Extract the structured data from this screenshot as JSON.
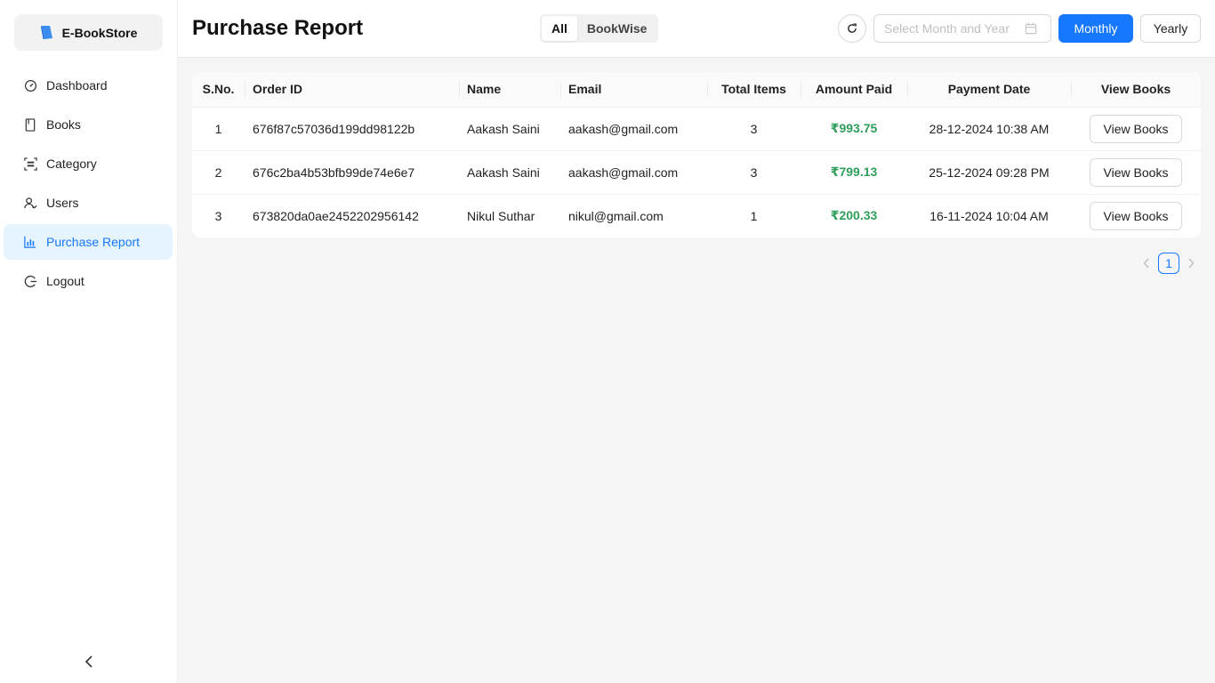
{
  "sidebar": {
    "brand": "E-BookStore",
    "items": [
      {
        "label": "Dashboard",
        "icon": "dashboard-icon"
      },
      {
        "label": "Books",
        "icon": "book-icon"
      },
      {
        "label": "Category",
        "icon": "category-icon"
      },
      {
        "label": "Users",
        "icon": "users-icon"
      },
      {
        "label": "Purchase Report",
        "icon": "bar-chart-icon",
        "active": true
      },
      {
        "label": "Logout",
        "icon": "logout-icon"
      }
    ]
  },
  "header": {
    "title": "Purchase Report",
    "segments": [
      "All",
      "BookWise"
    ],
    "selected_segment": "All",
    "date_placeholder": "Select Month and Year",
    "monthly_label": "Monthly",
    "yearly_label": "Yearly"
  },
  "table": {
    "columns": [
      "S.No.",
      "Order ID",
      "Name",
      "Email",
      "Total Items",
      "Amount Paid",
      "Payment Date",
      "View Books"
    ],
    "rows": [
      {
        "sno": "1",
        "order_id": "676f87c57036d199dd98122b",
        "name": "Aakash Saini",
        "email": "aakash@gmail.com",
        "items": "3",
        "amount": "₹993.75",
        "date": "28-12-2024 10:38 AM",
        "action": "View Books"
      },
      {
        "sno": "2",
        "order_id": "676c2ba4b53bfb99de74e6e7",
        "name": "Aakash Saini",
        "email": "aakash@gmail.com",
        "items": "3",
        "amount": "₹799.13",
        "date": "25-12-2024 09:28 PM",
        "action": "View Books"
      },
      {
        "sno": "3",
        "order_id": "673820da0ae2452202956142",
        "name": "Nikul Suthar",
        "email": "nikul@gmail.com",
        "items": "1",
        "amount": "₹200.33",
        "date": "16-11-2024 10:04 AM",
        "action": "View Books"
      }
    ]
  },
  "pagination": {
    "current": "1"
  },
  "colors": {
    "primary": "#1677ff",
    "amount": "#2e9e5b",
    "active_bg": "#e6f4ff"
  }
}
